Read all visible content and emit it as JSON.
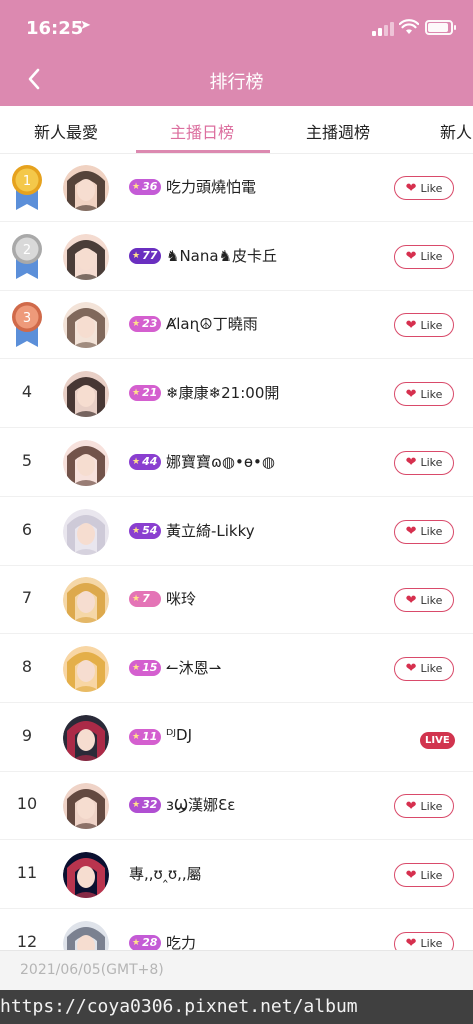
{
  "status_bar": {
    "time": "16:25",
    "location_glyph": "➤"
  },
  "header": {
    "title": "排行榜",
    "back_icon": "chevron-left-icon"
  },
  "tabs": [
    {
      "label": "新人最愛"
    },
    {
      "label": "主播日榜",
      "active": true
    },
    {
      "label": "主播週榜"
    },
    {
      "label": "新人"
    }
  ],
  "like_label": "Like",
  "live_label": "LIVE",
  "rows": [
    {
      "rank": "1",
      "medal": "gold",
      "level": "36",
      "level_color": "#c45bd6",
      "name": "吃力頭燒怕電"
    },
    {
      "rank": "2",
      "medal": "silver",
      "level": "77",
      "level_color": "#6a2fc0",
      "name": "♞Nana♞皮卡丘"
    },
    {
      "rank": "3",
      "medal": "bronze",
      "level": "23",
      "level_color": "#d45fcf",
      "name": "Ⱥlaɳ☮丁曉雨"
    },
    {
      "rank": "4",
      "level": "21",
      "level_color": "#d45fcf",
      "name": "❄康康❄21:00開"
    },
    {
      "rank": "5",
      "level": "44",
      "level_color": "#8a3fd0",
      "name": "娜寶寶ɷ◍•ɵ•◍"
    },
    {
      "rank": "6",
      "level": "54",
      "level_color": "#8a3fd0",
      "name": "黃立綺-Likky"
    },
    {
      "rank": "7",
      "level": "7",
      "level_color": "#e474b6",
      "name": "咪玲"
    },
    {
      "rank": "8",
      "level": "15",
      "level_color": "#d45fcf",
      "name": "↼沐恩⇀"
    },
    {
      "rank": "9",
      "level": "11",
      "level_color": "#d45fcf",
      "name": "ᴰᴶDJ",
      "live": true
    },
    {
      "rank": "10",
      "level": "32",
      "level_color": "#b04fd2",
      "name": "ɜϢ漢娜Ɛɛ"
    },
    {
      "rank": "11",
      "level": "",
      "level_color": "",
      "name": "專,,ʊ‸ʊ,,屬"
    },
    {
      "rank": "12",
      "level": "28",
      "level_color": "#c45bd6",
      "name": "吃力"
    }
  ],
  "footer": {
    "date": "2021/06/05(GMT+8)"
  },
  "watermark": "https://coya0306.pixnet.net/album",
  "colors": {
    "header_bg": "#dc89b0",
    "active_tab": "#dc6f9f",
    "like_border": "#d94a6a",
    "live_bg": "#d1344e"
  }
}
